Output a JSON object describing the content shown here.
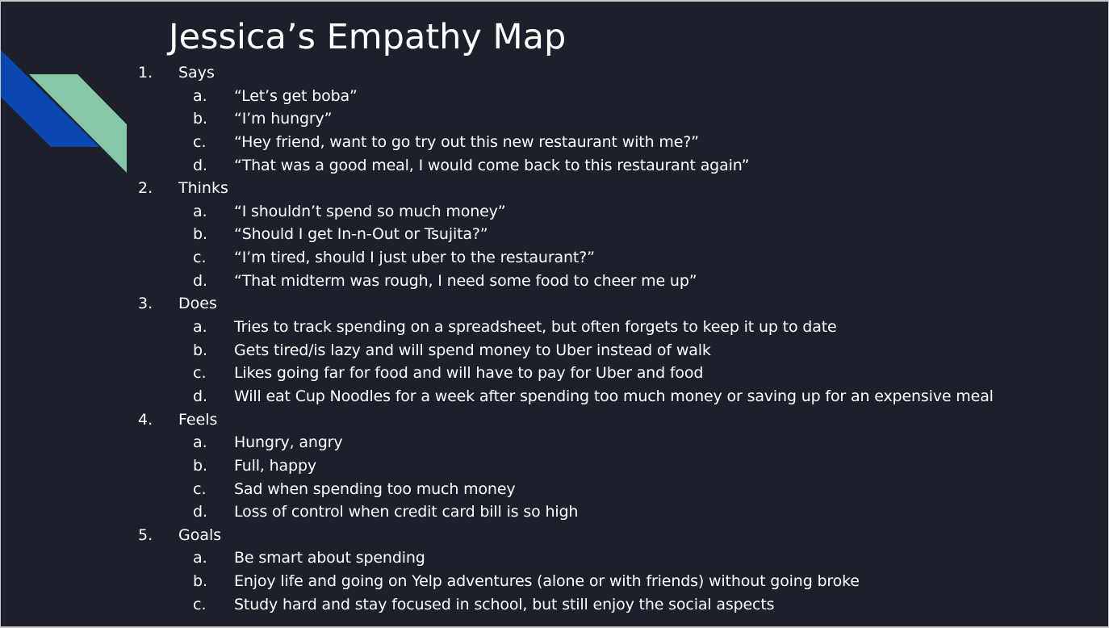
{
  "title": "Jessica’s Empathy Map",
  "colors": {
    "background": "#1b202b",
    "accent_blue": "#0a47ae",
    "accent_mint": "#85c7a6",
    "text": "#ffffff"
  },
  "sections": [
    {
      "number": "1.",
      "label": "Says",
      "items": [
        {
          "letter": "a.",
          "text": "“Let’s get boba”"
        },
        {
          "letter": "b.",
          "text": "“I’m hungry”"
        },
        {
          "letter": "c.",
          "text": "“Hey friend, want to go try out this new restaurant with me?”"
        },
        {
          "letter": "d.",
          "text": "“That was a good meal, I would come back to this restaurant again”"
        }
      ]
    },
    {
      "number": "2.",
      "label": "Thinks",
      "items": [
        {
          "letter": "a.",
          "text": "“I shouldn’t spend so much money”"
        },
        {
          "letter": "b.",
          "text": "“Should I get In-n-Out or Tsujita?”"
        },
        {
          "letter": "c.",
          "text": "“I’m tired, should I just uber to the restaurant?”"
        },
        {
          "letter": "d.",
          "text": "“That midterm was rough, I need some food to cheer me up”"
        }
      ]
    },
    {
      "number": "3.",
      "label": "Does",
      "items": [
        {
          "letter": "a.",
          "text": "Tries to track spending on a spreadsheet, but often forgets to keep it up to date"
        },
        {
          "letter": "b.",
          "text": "Gets tired/is lazy and will spend money to Uber instead of walk"
        },
        {
          "letter": "c.",
          "text": "Likes going far for food and will have to pay for Uber and food"
        },
        {
          "letter": "d.",
          "text": "Will eat Cup Noodles for a week after spending too much money or saving up for an expensive meal"
        }
      ]
    },
    {
      "number": "4.",
      "label": "Feels",
      "items": [
        {
          "letter": "a.",
          "text": "Hungry, angry"
        },
        {
          "letter": "b.",
          "text": "Full, happy"
        },
        {
          "letter": "c.",
          "text": "Sad when spending too much money"
        },
        {
          "letter": "d.",
          "text": "Loss of control when credit card bill is so high"
        }
      ]
    },
    {
      "number": "5.",
      "label": "Goals",
      "items": [
        {
          "letter": "a.",
          "text": "Be smart about spending"
        },
        {
          "letter": "b.",
          "text": "Enjoy life and going on Yelp adventures (alone or with friends) without going broke"
        },
        {
          "letter": "c.",
          "text": "Study hard and stay focused in school, but still enjoy the social aspects"
        }
      ]
    }
  ]
}
